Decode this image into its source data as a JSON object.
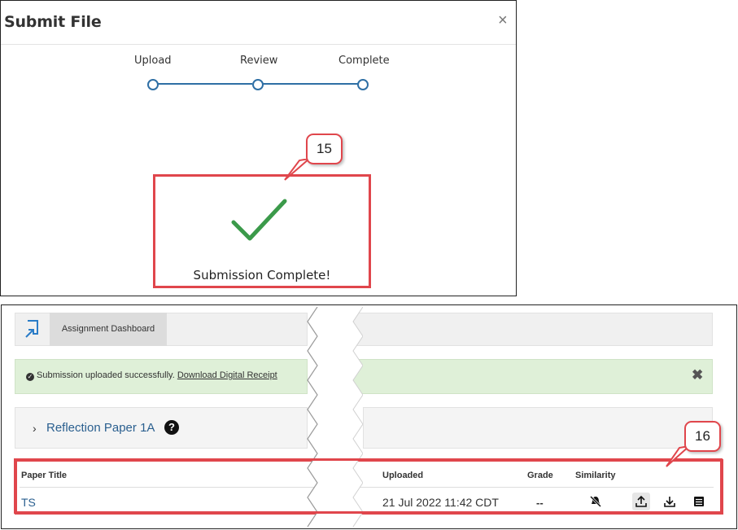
{
  "modal": {
    "title": "Submit File",
    "close": "×",
    "steps": [
      {
        "label": "Upload"
      },
      {
        "label": "Review"
      },
      {
        "label": "Complete"
      }
    ],
    "status_text": "Submission Complete!"
  },
  "callouts": {
    "first": "15",
    "second": "16"
  },
  "dashboard": {
    "tab_label": "Assignment Dashboard",
    "alert": {
      "text": "Submission uploaded successfully.",
      "link": "Download Digital Receipt",
      "close": "✖"
    },
    "assignment": {
      "chevron": "›",
      "title": "Reflection Paper 1A",
      "help": "?"
    },
    "table": {
      "headers": {
        "paper_title": "Paper Title",
        "uploaded": "Uploaded",
        "grade": "Grade",
        "similarity": "Similarity"
      },
      "row": {
        "paper_title": "TS",
        "uploaded": "21 Jul 2022 11:42 CDT",
        "grade": "--"
      },
      "icons": [
        "similarity-off-icon",
        "upload-icon",
        "download-icon",
        "receipt-icon"
      ]
    }
  },
  "colors": {
    "highlight": "#e0464c",
    "link": "#2a5f8f",
    "check": "#3b9a4a",
    "stepper": "#2f6fa5",
    "alert_bg": "#dff0d8"
  }
}
